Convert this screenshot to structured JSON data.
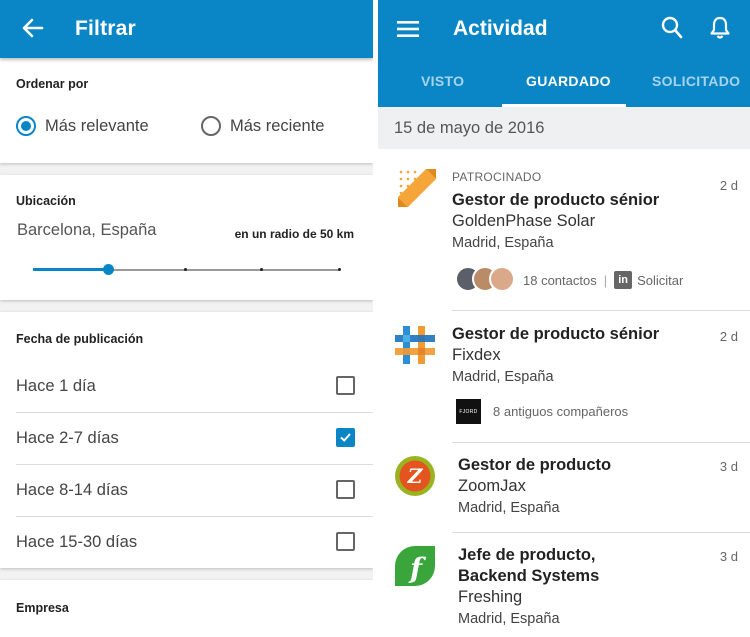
{
  "left": {
    "header": {
      "title": "Filtrar"
    },
    "order": {
      "title": "Ordenar por",
      "options": [
        {
          "label": "Más relevante",
          "selected": true
        },
        {
          "label": "Más reciente",
          "selected": false
        }
      ]
    },
    "location": {
      "title": "Ubicación",
      "city": "Barcelona, España",
      "radius": "en un radio de 50 km",
      "slider_fraction": 0.24
    },
    "date": {
      "title": "Fecha de publicación",
      "options": [
        {
          "label": "Hace 1 día",
          "checked": false
        },
        {
          "label": "Hace 2-7 días",
          "checked": true
        },
        {
          "label": "Hace 8-14 días",
          "checked": false
        },
        {
          "label": "Hace 15-30 días",
          "checked": false
        }
      ]
    },
    "company": {
      "title": "Empresa"
    }
  },
  "right": {
    "header": {
      "title": "Actividad"
    },
    "tabs": [
      {
        "label": "VISTO",
        "active": false
      },
      {
        "label": "GUARDADO",
        "active": true
      },
      {
        "label": "SOLICITADO",
        "active": false
      }
    ],
    "date": "15 de mayo de 2016",
    "jobs": [
      {
        "sponsored": "PATROCINADO",
        "title": "Gestor de producto sénior",
        "company": "GoldenPhase Solar",
        "location": "Madrid, España",
        "age": "2 d",
        "contacts": "18 contactos",
        "apply": "Solicitar",
        "logo": "goldenphase-logo"
      },
      {
        "title": "Gestor de producto sénior",
        "company": "Fixdex",
        "location": "Madrid, España",
        "age": "2 d",
        "colleagues": "8 antiguos compañeros",
        "colleagues_badge": "FJORD",
        "logo": "fixdex-logo"
      },
      {
        "title": "Gestor de producto",
        "company": "ZoomJax",
        "location": "Madrid, España",
        "age": "3 d",
        "logo_letter": "Z"
      },
      {
        "title_line1": "Jefe de producto,",
        "title_line2": "Backend Systems",
        "company": "Freshing",
        "location": "Madrid, España",
        "age": "3 d",
        "logo_letter": "f"
      }
    ]
  },
  "colors": {
    "brand_blue": "#0a86c6",
    "tab_inactive": "#a7d3ec"
  }
}
